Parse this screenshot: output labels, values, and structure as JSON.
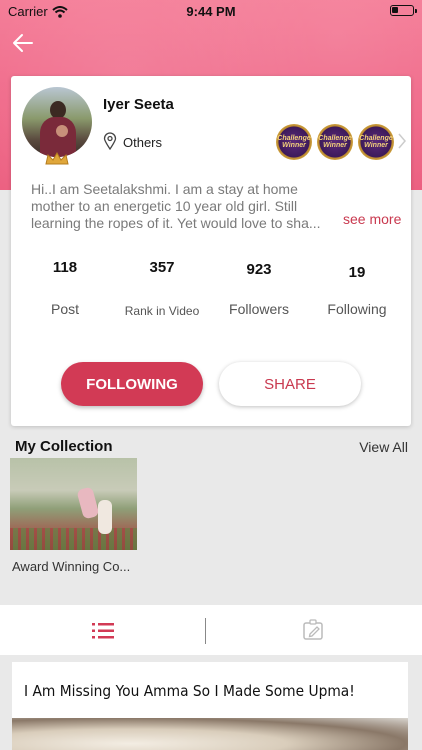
{
  "status_bar": {
    "carrier": "Carrier",
    "time": "9:44 PM"
  },
  "profile": {
    "name": "Iyer Seeta",
    "location": "Others",
    "badges": [
      "Challenge Winner",
      "Challenge Winner",
      "Challenge Winner"
    ],
    "bio": "Hi..I am Seetalakshmi. I am a stay at home mother to an energetic 10 year old girl. Still learning the ropes of it. Yet would love to sha...",
    "see_more": "see more"
  },
  "stats": [
    {
      "value": "118",
      "label": "Post"
    },
    {
      "value": "357",
      "label": "Rank in Video"
    },
    {
      "value": "923",
      "label": "Followers"
    },
    {
      "value": "19",
      "label": "Following"
    }
  ],
  "actions": {
    "following": "FOLLOWING",
    "share": "SHARE"
  },
  "collection": {
    "title": "My Collection",
    "view_all": "View All",
    "items": [
      {
        "caption": "Award Winning Co..."
      }
    ]
  },
  "tabs": {
    "list": "list-icon",
    "edit": "edit-icon"
  },
  "post": {
    "title": "I Am Missing You Amma So I Made Some Upma!"
  },
  "colors": {
    "accent": "#d23a55",
    "header": "#f06a8a"
  }
}
